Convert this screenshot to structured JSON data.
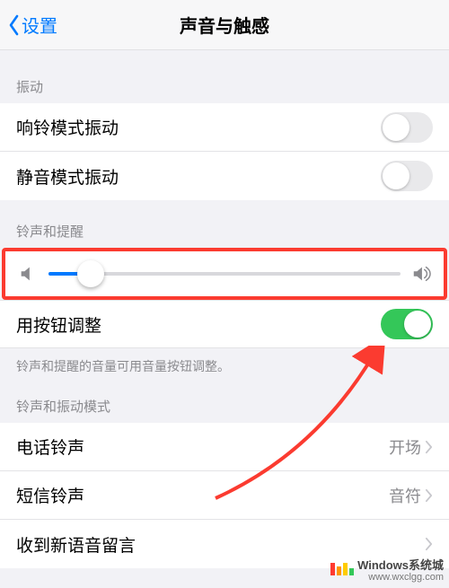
{
  "nav": {
    "back": "设置",
    "title": "声音与触感"
  },
  "sections": {
    "vibration": {
      "header": "振动",
      "ring": "响铃模式振动",
      "silent": "静音模式振动",
      "ring_on": false,
      "silent_on": false
    },
    "ringer": {
      "header": "铃声和提醒",
      "slider_pct": 12,
      "adjust_label": "用按钮调整",
      "adjust_on": true,
      "caption": "铃声和提醒的音量可用音量按钮调整。"
    },
    "patterns": {
      "header": "铃声和振动模式",
      "ringtone_label": "电话铃声",
      "ringtone_value": "开场",
      "text_label": "短信铃声",
      "text_value": "音符",
      "voicemail_label": "收到新语音留言"
    }
  },
  "watermark": {
    "main": "Windows系统城",
    "url": "www.wxclgg.com"
  },
  "colors": {
    "accent": "#007aff",
    "highlight": "#fb3b30",
    "switch_on": "#34c759"
  }
}
